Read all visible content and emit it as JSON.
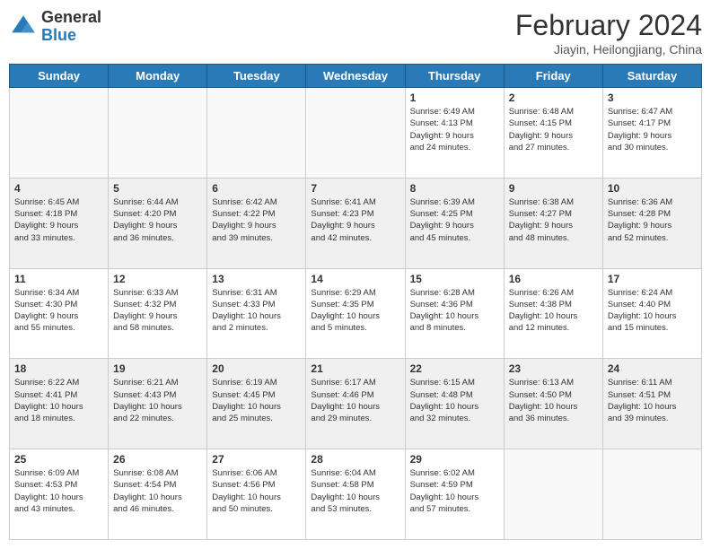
{
  "header": {
    "logo_general": "General",
    "logo_blue": "Blue",
    "month_title": "February 2024",
    "subtitle": "Jiayin, Heilongjiang, China"
  },
  "weekdays": [
    "Sunday",
    "Monday",
    "Tuesday",
    "Wednesday",
    "Thursday",
    "Friday",
    "Saturday"
  ],
  "weeks": [
    [
      {
        "day": "",
        "info": ""
      },
      {
        "day": "",
        "info": ""
      },
      {
        "day": "",
        "info": ""
      },
      {
        "day": "",
        "info": ""
      },
      {
        "day": "1",
        "info": "Sunrise: 6:49 AM\nSunset: 4:13 PM\nDaylight: 9 hours\nand 24 minutes."
      },
      {
        "day": "2",
        "info": "Sunrise: 6:48 AM\nSunset: 4:15 PM\nDaylight: 9 hours\nand 27 minutes."
      },
      {
        "day": "3",
        "info": "Sunrise: 6:47 AM\nSunset: 4:17 PM\nDaylight: 9 hours\nand 30 minutes."
      }
    ],
    [
      {
        "day": "4",
        "info": "Sunrise: 6:45 AM\nSunset: 4:18 PM\nDaylight: 9 hours\nand 33 minutes."
      },
      {
        "day": "5",
        "info": "Sunrise: 6:44 AM\nSunset: 4:20 PM\nDaylight: 9 hours\nand 36 minutes."
      },
      {
        "day": "6",
        "info": "Sunrise: 6:42 AM\nSunset: 4:22 PM\nDaylight: 9 hours\nand 39 minutes."
      },
      {
        "day": "7",
        "info": "Sunrise: 6:41 AM\nSunset: 4:23 PM\nDaylight: 9 hours\nand 42 minutes."
      },
      {
        "day": "8",
        "info": "Sunrise: 6:39 AM\nSunset: 4:25 PM\nDaylight: 9 hours\nand 45 minutes."
      },
      {
        "day": "9",
        "info": "Sunrise: 6:38 AM\nSunset: 4:27 PM\nDaylight: 9 hours\nand 48 minutes."
      },
      {
        "day": "10",
        "info": "Sunrise: 6:36 AM\nSunset: 4:28 PM\nDaylight: 9 hours\nand 52 minutes."
      }
    ],
    [
      {
        "day": "11",
        "info": "Sunrise: 6:34 AM\nSunset: 4:30 PM\nDaylight: 9 hours\nand 55 minutes."
      },
      {
        "day": "12",
        "info": "Sunrise: 6:33 AM\nSunset: 4:32 PM\nDaylight: 9 hours\nand 58 minutes."
      },
      {
        "day": "13",
        "info": "Sunrise: 6:31 AM\nSunset: 4:33 PM\nDaylight: 10 hours\nand 2 minutes."
      },
      {
        "day": "14",
        "info": "Sunrise: 6:29 AM\nSunset: 4:35 PM\nDaylight: 10 hours\nand 5 minutes."
      },
      {
        "day": "15",
        "info": "Sunrise: 6:28 AM\nSunset: 4:36 PM\nDaylight: 10 hours\nand 8 minutes."
      },
      {
        "day": "16",
        "info": "Sunrise: 6:26 AM\nSunset: 4:38 PM\nDaylight: 10 hours\nand 12 minutes."
      },
      {
        "day": "17",
        "info": "Sunrise: 6:24 AM\nSunset: 4:40 PM\nDaylight: 10 hours\nand 15 minutes."
      }
    ],
    [
      {
        "day": "18",
        "info": "Sunrise: 6:22 AM\nSunset: 4:41 PM\nDaylight: 10 hours\nand 18 minutes."
      },
      {
        "day": "19",
        "info": "Sunrise: 6:21 AM\nSunset: 4:43 PM\nDaylight: 10 hours\nand 22 minutes."
      },
      {
        "day": "20",
        "info": "Sunrise: 6:19 AM\nSunset: 4:45 PM\nDaylight: 10 hours\nand 25 minutes."
      },
      {
        "day": "21",
        "info": "Sunrise: 6:17 AM\nSunset: 4:46 PM\nDaylight: 10 hours\nand 29 minutes."
      },
      {
        "day": "22",
        "info": "Sunrise: 6:15 AM\nSunset: 4:48 PM\nDaylight: 10 hours\nand 32 minutes."
      },
      {
        "day": "23",
        "info": "Sunrise: 6:13 AM\nSunset: 4:50 PM\nDaylight: 10 hours\nand 36 minutes."
      },
      {
        "day": "24",
        "info": "Sunrise: 6:11 AM\nSunset: 4:51 PM\nDaylight: 10 hours\nand 39 minutes."
      }
    ],
    [
      {
        "day": "25",
        "info": "Sunrise: 6:09 AM\nSunset: 4:53 PM\nDaylight: 10 hours\nand 43 minutes."
      },
      {
        "day": "26",
        "info": "Sunrise: 6:08 AM\nSunset: 4:54 PM\nDaylight: 10 hours\nand 46 minutes."
      },
      {
        "day": "27",
        "info": "Sunrise: 6:06 AM\nSunset: 4:56 PM\nDaylight: 10 hours\nand 50 minutes."
      },
      {
        "day": "28",
        "info": "Sunrise: 6:04 AM\nSunset: 4:58 PM\nDaylight: 10 hours\nand 53 minutes."
      },
      {
        "day": "29",
        "info": "Sunrise: 6:02 AM\nSunset: 4:59 PM\nDaylight: 10 hours\nand 57 minutes."
      },
      {
        "day": "",
        "info": ""
      },
      {
        "day": "",
        "info": ""
      }
    ]
  ]
}
